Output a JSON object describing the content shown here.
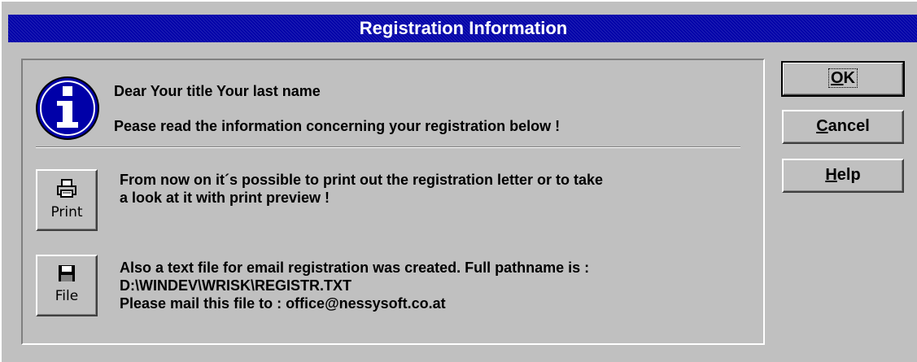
{
  "window": {
    "title": "Registration Information"
  },
  "message": {
    "greeting": "Dear  Your title Your last name",
    "notice": "Pease read the information concerning your registration below !"
  },
  "print_section": {
    "button_label": "Print",
    "text_line1": "From now on it´s possible to print out the registration letter or to take",
    "text_line2": "a look at it with print preview !"
  },
  "file_section": {
    "button_label": "File",
    "text_line1": "Also a text file for email registration was created. Full pathname is :",
    "path": "D:\\WINDEV\\WRISK\\REGISTR.TXT",
    "text_line3": "Please mail this file to : office@nessysoft.co.at"
  },
  "buttons": {
    "ok_mnemonic": "O",
    "ok_rest": "K",
    "cancel_mnemonic": "C",
    "cancel_rest": "ancel",
    "help_mnemonic": "H",
    "help_rest": "elp"
  },
  "icons": {
    "info": "info-icon",
    "print": "printer-icon",
    "file": "floppy-disk-icon"
  },
  "colors": {
    "title_bar": "#0000a8",
    "dialog_bg": "#c0c0c0",
    "info_circle": "#0000a8"
  }
}
